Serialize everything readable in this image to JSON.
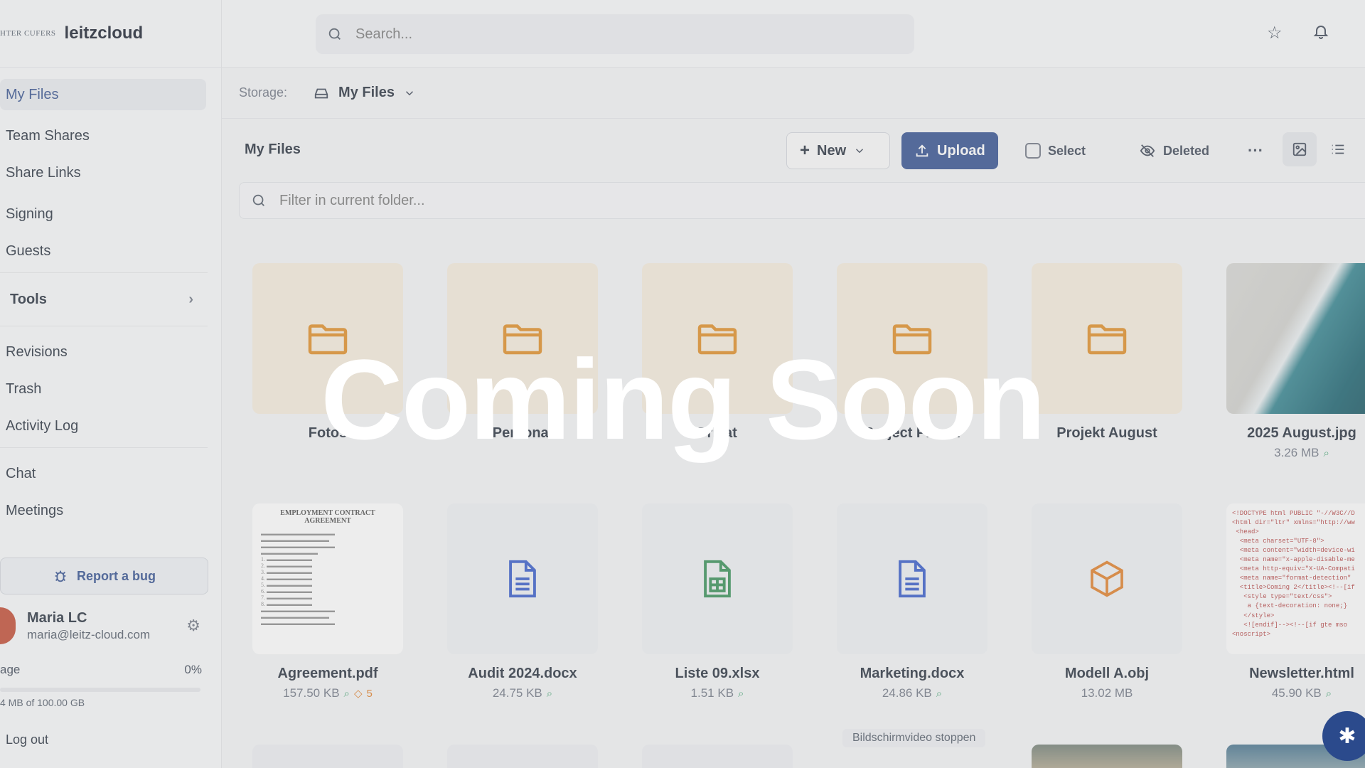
{
  "brand": {
    "small": "HTER CUFERS",
    "name": "leitzcloud"
  },
  "search": {
    "placeholder": "Search..."
  },
  "sidebar": {
    "items": [
      {
        "label": "My Files"
      },
      {
        "label": "Team Shares"
      },
      {
        "label": "Share Links"
      },
      {
        "label": "Signing"
      },
      {
        "label": "Guests"
      },
      {
        "label": "Tools"
      },
      {
        "label": "Revisions"
      },
      {
        "label": "Trash"
      },
      {
        "label": "Activity Log"
      },
      {
        "label": "Chat"
      },
      {
        "label": "Meetings"
      }
    ],
    "report_bug": "Report a bug",
    "user": {
      "name": "Maria LC",
      "email": "maria@leitz-cloud.com"
    },
    "storage": {
      "label": "age",
      "percent": "0%",
      "detail": "4 MB of 100.00 GB",
      "fill": 0
    },
    "logout": "Log out"
  },
  "storage_bar": {
    "label": "Storage:",
    "selected": "My Files"
  },
  "toolbar": {
    "title": "My Files",
    "new_label": "New",
    "upload_label": "Upload",
    "select_label": "Select",
    "deleted_label": "Deleted",
    "more_label": "···",
    "filter_placeholder": "Filter in current folder..."
  },
  "files": [
    {
      "name": "Fotos",
      "type": "folder"
    },
    {
      "name": "Personal",
      "type": "folder"
    },
    {
      "name": "Privat",
      "type": "folder"
    },
    {
      "name": "Project Plan A",
      "type": "folder"
    },
    {
      "name": "Projekt August",
      "type": "folder"
    },
    {
      "name": "2025 August.jpg",
      "type": "image",
      "size": "3.26 MB"
    },
    {
      "name": "Agreement.pdf",
      "type": "pdf",
      "size": "157.50 KB",
      "tags": "5",
      "doc_title": "EMPLOYMENT CONTRACT AGREEMENT"
    },
    {
      "name": "Audit 2024.docx",
      "type": "docx",
      "size": "24.75 KB"
    },
    {
      "name": "Liste 09.xlsx",
      "type": "xlsx",
      "size": "1.51 KB"
    },
    {
      "name": "Marketing.docx",
      "type": "docx",
      "size": "24.86 KB"
    },
    {
      "name": "Modell A.obj",
      "type": "obj",
      "size": "13.02 MB"
    },
    {
      "name": "Newsletter.html",
      "type": "html",
      "size": "45.90 KB",
      "preview": "<!DOCTYPE html PUBLIC \"-//W3C//D\n<html dir=\"ltr\" xmlns=\"http://ww\n <head>\n  <meta charset=\"UTF-8\">\n  <meta content=\"width=device-wi\n  <meta name=\"x-apple-disable-me\n  <meta http-equiv=\"X-UA-Compati\n  <meta name=\"format-detection\"\n  <title>Coming 2</title><!--[if\n   <style type=\"text/css\">\n    a {text-decoration: none;}\n   </style>\n   <![endif]--><!--[if gte mso\n<noscript>"
    }
  ],
  "hint": "Bildschirmvideo stoppen",
  "overlay_text": "Coming Soon",
  "colors": {
    "accent": "#2b4a8c",
    "folder_icon": "#e08a1e",
    "docx_icon": "#2f55c8",
    "xlsx_icon": "#2e8b4f",
    "obj_icon": "#e07a20"
  }
}
